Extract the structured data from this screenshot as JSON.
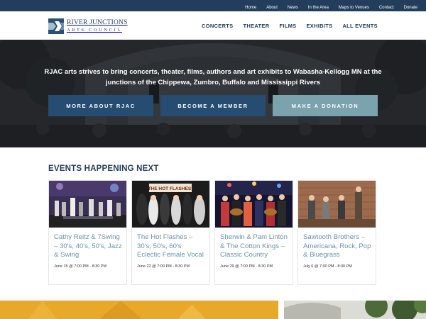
{
  "topnav": {
    "items": [
      "Home",
      "About",
      "News",
      "In the Area",
      "Maps to Venues",
      "Contact",
      "Donate"
    ]
  },
  "logo": {
    "line1": "RIVER JUNCTIONS",
    "line2": "ARTS COUNCIL"
  },
  "mainnav": {
    "items": [
      "CONCERTS",
      "THEATER",
      "FILMS",
      "EXHIBITS",
      "ALL EVENTS"
    ]
  },
  "hero": {
    "text": "RJAC arts strives to bring concerts, theater, films, authors and art exhibits to Wabasha-Kellogg MN at the junctions of the Chippewa, Zumbro, Buffalo and Mississippi Rivers",
    "buttons": [
      "MORE ABOUT RJAC",
      "BECOME A MEMBER",
      "MAKE A DONATION"
    ]
  },
  "events": {
    "heading": "EVENTS HAPPENING NEXT",
    "poster_text": "THE HOT FLASHES!",
    "cards": [
      {
        "title": "Cathy Reitz & 7Swing – 30's, 40's, 50's, Jazz & Swing",
        "date": "June 15 @ 7:00 PM - 8:30 PM"
      },
      {
        "title": "The Hot Flashes – 30's, 50's, 60's Eclectic Female Vocal",
        "date": "June 22 @ 7:00 PM - 8:30 PM"
      },
      {
        "title": "Sherwin & Pam Linton & The Cotton Kings – Classic Country",
        "date": "June 29 @ 7:00 PM - 8:30 PM"
      },
      {
        "title": "Sawtooth Brothers – Americana, Rock, Pop & Bluegrass",
        "date": "July 6 @ 7:00 PM - 8:30 PM"
      }
    ]
  },
  "colors": {
    "topbar": "#233d5c",
    "button_blue": "#264c72",
    "button_light": "#7ba3ae",
    "event_title": "#6a93a9",
    "promo_yellow": "#e8a92a"
  }
}
